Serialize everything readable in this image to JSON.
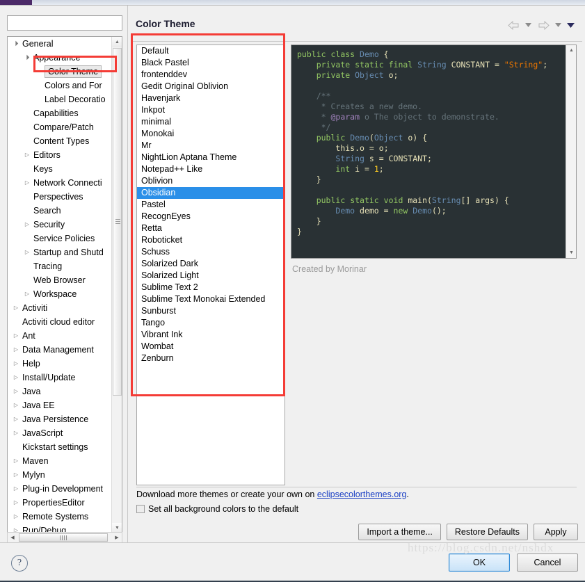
{
  "window": {
    "dialog_title": "Color Theme"
  },
  "left_panel": {
    "filter_placeholder": "",
    "filter_value": "",
    "tree": [
      {
        "label": "General",
        "depth": 0,
        "arrow": "expanded"
      },
      {
        "label": "Appearance",
        "depth": 1,
        "arrow": "expanded"
      },
      {
        "label": "Color Theme",
        "depth": 2,
        "arrow": "none",
        "selected": true
      },
      {
        "label": "Colors and For",
        "depth": 2,
        "arrow": "none"
      },
      {
        "label": "Label Decoratio",
        "depth": 2,
        "arrow": "none"
      },
      {
        "label": "Capabilities",
        "depth": 1,
        "arrow": "none"
      },
      {
        "label": "Compare/Patch",
        "depth": 1,
        "arrow": "none"
      },
      {
        "label": "Content Types",
        "depth": 1,
        "arrow": "none"
      },
      {
        "label": "Editors",
        "depth": 1,
        "arrow": "collapsed"
      },
      {
        "label": "Keys",
        "depth": 1,
        "arrow": "none"
      },
      {
        "label": "Network Connecti",
        "depth": 1,
        "arrow": "collapsed"
      },
      {
        "label": "Perspectives",
        "depth": 1,
        "arrow": "none"
      },
      {
        "label": "Search",
        "depth": 1,
        "arrow": "none"
      },
      {
        "label": "Security",
        "depth": 1,
        "arrow": "collapsed"
      },
      {
        "label": "Service Policies",
        "depth": 1,
        "arrow": "none"
      },
      {
        "label": "Startup and Shutd",
        "depth": 1,
        "arrow": "collapsed"
      },
      {
        "label": "Tracing",
        "depth": 1,
        "arrow": "none"
      },
      {
        "label": "Web Browser",
        "depth": 1,
        "arrow": "none"
      },
      {
        "label": "Workspace",
        "depth": 1,
        "arrow": "collapsed"
      },
      {
        "label": "Activiti",
        "depth": 0,
        "arrow": "collapsed"
      },
      {
        "label": "Activiti cloud editor",
        "depth": 0,
        "arrow": "none"
      },
      {
        "label": "Ant",
        "depth": 0,
        "arrow": "collapsed"
      },
      {
        "label": "Data Management",
        "depth": 0,
        "arrow": "collapsed"
      },
      {
        "label": "Help",
        "depth": 0,
        "arrow": "collapsed"
      },
      {
        "label": "Install/Update",
        "depth": 0,
        "arrow": "collapsed"
      },
      {
        "label": "Java",
        "depth": 0,
        "arrow": "collapsed"
      },
      {
        "label": "Java EE",
        "depth": 0,
        "arrow": "collapsed"
      },
      {
        "label": "Java Persistence",
        "depth": 0,
        "arrow": "collapsed"
      },
      {
        "label": "JavaScript",
        "depth": 0,
        "arrow": "collapsed"
      },
      {
        "label": "Kickstart settings",
        "depth": 0,
        "arrow": "none"
      },
      {
        "label": "Maven",
        "depth": 0,
        "arrow": "collapsed"
      },
      {
        "label": "Mylyn",
        "depth": 0,
        "arrow": "collapsed"
      },
      {
        "label": "Plug-in Development",
        "depth": 0,
        "arrow": "collapsed"
      },
      {
        "label": "PropertiesEditor",
        "depth": 0,
        "arrow": "collapsed"
      },
      {
        "label": "Remote Systems",
        "depth": 0,
        "arrow": "collapsed"
      },
      {
        "label": "Run/Debug",
        "depth": 0,
        "arrow": "collapsed"
      }
    ]
  },
  "theme_list": {
    "selected": "Obsidian",
    "items": [
      "Default",
      "Black Pastel",
      "frontenddev",
      "Gedit Original Oblivion",
      "Havenjark",
      "Inkpot",
      "minimal",
      "Monokai",
      "Mr",
      "NightLion Aptana Theme",
      "Notepad++ Like",
      "Oblivion",
      "Obsidian",
      "Pastel",
      "RecognEyes",
      "Retta",
      "Roboticket",
      "Schuss",
      "Solarized Dark",
      "Solarized Light",
      "Sublime Text 2",
      "Sublime Text Monokai Extended",
      "Sunburst",
      "Tango",
      "Vibrant Ink",
      "Wombat",
      "Zenburn"
    ]
  },
  "preview": {
    "author_note": "Created by Morinar",
    "background_color": "#293134",
    "colors": {
      "keyword": "#93c763",
      "type": "#678cb1",
      "string": "#ec7600",
      "comment": "#66747b",
      "javadoc_tag": "#a082bd",
      "number": "#ffcd22",
      "plain": "#e8e2b7"
    },
    "code_lines": [
      "public class Demo {",
      "    private static final String CONSTANT = \"String\";",
      "    private Object o;",
      "",
      "    /**",
      "     * Creates a new demo.",
      "     * @param o The object to demonstrate.",
      "     */",
      "    public Demo(Object o) {",
      "        this.o = o;",
      "        String s = CONSTANT;",
      "        int i = 1;",
      "    }",
      "",
      "    public static void main(String[] args) {",
      "        Demo demo = new Demo();",
      "    }",
      "}"
    ]
  },
  "footer_section": {
    "download_prefix": "Download more themes or create your own on ",
    "download_link": "eclipsecolorthemes.org",
    "download_suffix": ".",
    "checkbox_label": "Set all background colors to the default",
    "checkbox_checked": false,
    "buttons": {
      "import": "Import a theme...",
      "restore": "Restore Defaults",
      "apply": "Apply"
    }
  },
  "dialog_footer": {
    "help_icon": "?",
    "ok": "OK",
    "cancel": "Cancel"
  },
  "watermark": "https://blog.csdn.net/nshdx",
  "icons": {
    "back_arrow": "back-arrow-icon",
    "forward_arrow": "forward-arrow-icon",
    "caret_down": "chevron-down-icon"
  }
}
